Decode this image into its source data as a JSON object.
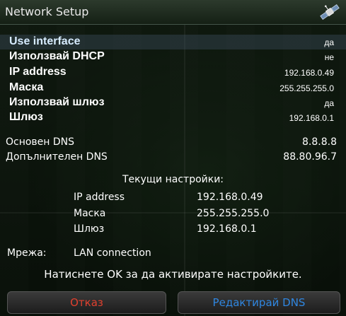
{
  "window": {
    "title": "Network Setup"
  },
  "settings": [
    {
      "label": "Use interface",
      "value": "да"
    },
    {
      "label": "Използвай DHCP",
      "value": "не"
    },
    {
      "label": "IP address",
      "value": "192.168.0.49"
    },
    {
      "label": "Маска",
      "value": "255.255.255.0"
    },
    {
      "label": "Използвай шлюз",
      "value": "да"
    },
    {
      "label": "Шлюз",
      "value": "192.168.0.1"
    }
  ],
  "dns": [
    {
      "label": "Основен DNS",
      "value": "8.8.8.8"
    },
    {
      "label": "Допълнителен DNS",
      "value": "88.80.96.7"
    }
  ],
  "current": {
    "title": "Текущи настройки:",
    "rows": [
      {
        "label": "IP address",
        "value": "192.168.0.49"
      },
      {
        "label": "Маска",
        "value": "255.255.255.0"
      },
      {
        "label": "Шлюз",
        "value": "192.168.0.1"
      }
    ]
  },
  "network": {
    "label": "Мрежа:",
    "value": "LAN connection"
  },
  "hint": "Натиснете OK за да активирате настройките.",
  "buttons": {
    "cancel": "Отказ",
    "edit_dns": "Редактирай DNS"
  },
  "colors": {
    "cancel": "#e0402e",
    "edit_dns": "#2f86e0"
  },
  "icons": {
    "title": "satellite-icon"
  }
}
